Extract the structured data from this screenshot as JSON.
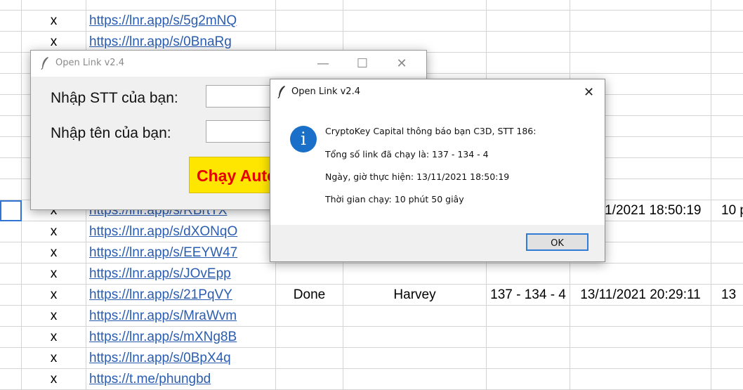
{
  "sheet": {
    "rows": [
      {
        "x": "",
        "link": "",
        "status": "",
        "name": "",
        "links": "",
        "datetime": "",
        "time": ""
      },
      {
        "x": "x",
        "link": "https://lnr.app/s/5g2mNQ",
        "status": "",
        "name": "",
        "links": "",
        "datetime": "",
        "time": ""
      },
      {
        "x": "x",
        "link": "https://lnr.app/s/0BnaRg",
        "status": "",
        "name": "",
        "links": "",
        "datetime": "",
        "time": ""
      },
      {
        "x": "",
        "link": "",
        "status": "",
        "name": "",
        "links": "",
        "datetime": "",
        "time": ""
      },
      {
        "x": "",
        "link": "",
        "status": "",
        "name": "",
        "links": "",
        "datetime": "",
        "time": ""
      },
      {
        "x": "",
        "link": "",
        "status": "",
        "name": "",
        "links": "",
        "datetime": "",
        "time": ""
      },
      {
        "x": "",
        "link": "",
        "status": "",
        "name": "",
        "links": "",
        "datetime": "",
        "time": ""
      },
      {
        "x": "",
        "link": "",
        "status": "",
        "name": "",
        "links": "",
        "datetime": "",
        "time": ""
      },
      {
        "x": "",
        "link": "",
        "status": "",
        "name": "",
        "links": "",
        "datetime": "",
        "time": ""
      },
      {
        "x": "",
        "link": "",
        "status": "",
        "name": "",
        "links": "",
        "datetime": "",
        "time": ""
      },
      {
        "x": "x",
        "link": "https://lnr.app/s/RBrtTX",
        "status": "",
        "name": "",
        "links": "",
        "datetime": "13/11/2021 18:50:19",
        "time": "10 p"
      },
      {
        "x": "x",
        "link": "https://lnr.app/s/dXONqO",
        "status": "",
        "name": "",
        "links": "",
        "datetime": "",
        "time": ""
      },
      {
        "x": "x",
        "link": "https://lnr.app/s/EEYW47",
        "status": "",
        "name": "",
        "links": "",
        "datetime": "",
        "time": ""
      },
      {
        "x": "x",
        "link": "https://lnr.app/s/JOvEpp",
        "status": "",
        "name": "",
        "links": "",
        "datetime": "",
        "time": ""
      },
      {
        "x": "x",
        "link": "https://lnr.app/s/21PqVY",
        "status": "Done",
        "name": "Harvey",
        "links": "137 - 134 - 4",
        "datetime": "13/11/2021 20:29:11",
        "time": "13"
      },
      {
        "x": "x",
        "link": "https://lnr.app/s/MraWvm",
        "status": "",
        "name": "",
        "links": "",
        "datetime": "",
        "time": ""
      },
      {
        "x": "x",
        "link": "https://lnr.app/s/mXNg8B",
        "status": "",
        "name": "",
        "links": "",
        "datetime": "",
        "time": ""
      },
      {
        "x": "x",
        "link": "https://lnr.app/s/0BpX4q",
        "status": "",
        "name": "",
        "links": "",
        "datetime": "",
        "time": ""
      },
      {
        "x": "x",
        "link": "https://t.me/phungbd",
        "status": "",
        "name": "",
        "links": "",
        "datetime": "",
        "time": ""
      }
    ]
  },
  "back_window": {
    "title": "Open Link v2.4",
    "minimize_glyph": "—",
    "maximize_glyph": "☐",
    "close_glyph": "✕",
    "label_stt": "Nhập STT của bạn:",
    "label_ten": "Nhập tên của bạn:",
    "input_stt_value": "",
    "input_ten_value": "",
    "run_button": "Chạy Auto"
  },
  "message_box": {
    "title": "Open Link v2.4",
    "close_glyph": "✕",
    "icon_glyph": "i",
    "line1": "CryptoKey Capital thông báo bạn C3D, STT 186:",
    "line2": "Tổng số link đã chạy là: 137 - 134 - 4",
    "line3": "Ngày, giờ thực hiện: 13/11/2021 18:50:19",
    "line4": "Thời gian chạy: 10 phút 50 giây",
    "ok_button": "OK"
  },
  "icons": {
    "app_icon": "feather-icon",
    "info_icon": "info-icon"
  },
  "colors": {
    "link": "#2a5db0",
    "run_button_bg": "#ffe600",
    "run_button_text": "#e60000",
    "info_icon": "#1a6fc9",
    "ok_focus": "#2f7bd6"
  }
}
